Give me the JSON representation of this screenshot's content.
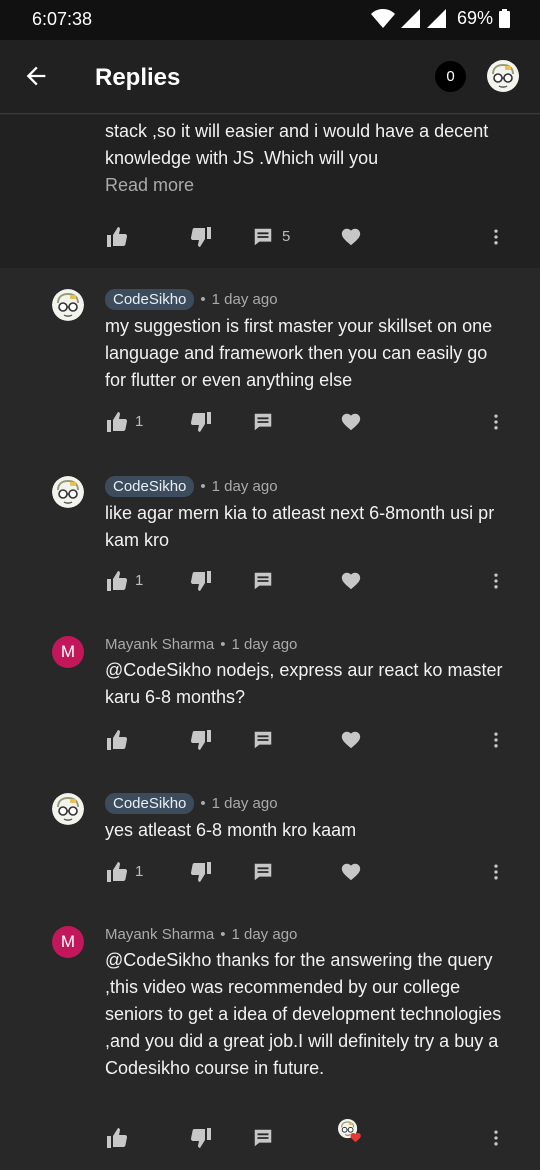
{
  "status": {
    "time": "6:07:38",
    "battery": "69%"
  },
  "header": {
    "title": "Replies",
    "count": "0"
  },
  "parent": {
    "text": "stack  ,so it will easier and i would have a decent knowledge with JS .Which will you",
    "read_more": "Read more",
    "reply_count": "5"
  },
  "replies": [
    {
      "author": "CodeSikho",
      "time": "1 day ago",
      "text": "my suggestion is first master your skillset on one language and framework then you can easily go for flutter or even anything else",
      "likes": "1"
    },
    {
      "author": "CodeSikho",
      "time": "1 day ago",
      "text": "like agar mern kia to atleast next 6-8month usi pr kam kro",
      "likes": "1"
    },
    {
      "author": "Mayank Sharma",
      "initial": "M",
      "time": "1 day ago",
      "text": "@CodeSikho nodejs, express aur react ko master karu 6-8 months?",
      "likes": ""
    },
    {
      "author": "CodeSikho",
      "time": "1 day ago",
      "text": "yes atleast 6-8 month kro kaam",
      "likes": "1"
    },
    {
      "author": "Mayank Sharma",
      "initial": "M",
      "time": "1 day ago",
      "text": "@CodeSikho thanks for the answering the query ,this video was recommended by our college seniors to get a idea of development technologies ,and you did a great job.I will definitely try a buy a Codesikho course in future.",
      "likes": ""
    }
  ],
  "icons": {
    "back": "arrow-left-icon",
    "like": "thumbs-up-icon",
    "dislike": "thumbs-down-icon",
    "reply": "comment-icon",
    "heart": "heart-icon",
    "more": "more-vert-icon"
  },
  "colors": {
    "background": "#282828",
    "header": "#212121",
    "author_chip": "#3d4c5c",
    "avatar_m": "#c2185b",
    "heart_red": "#e53935"
  }
}
